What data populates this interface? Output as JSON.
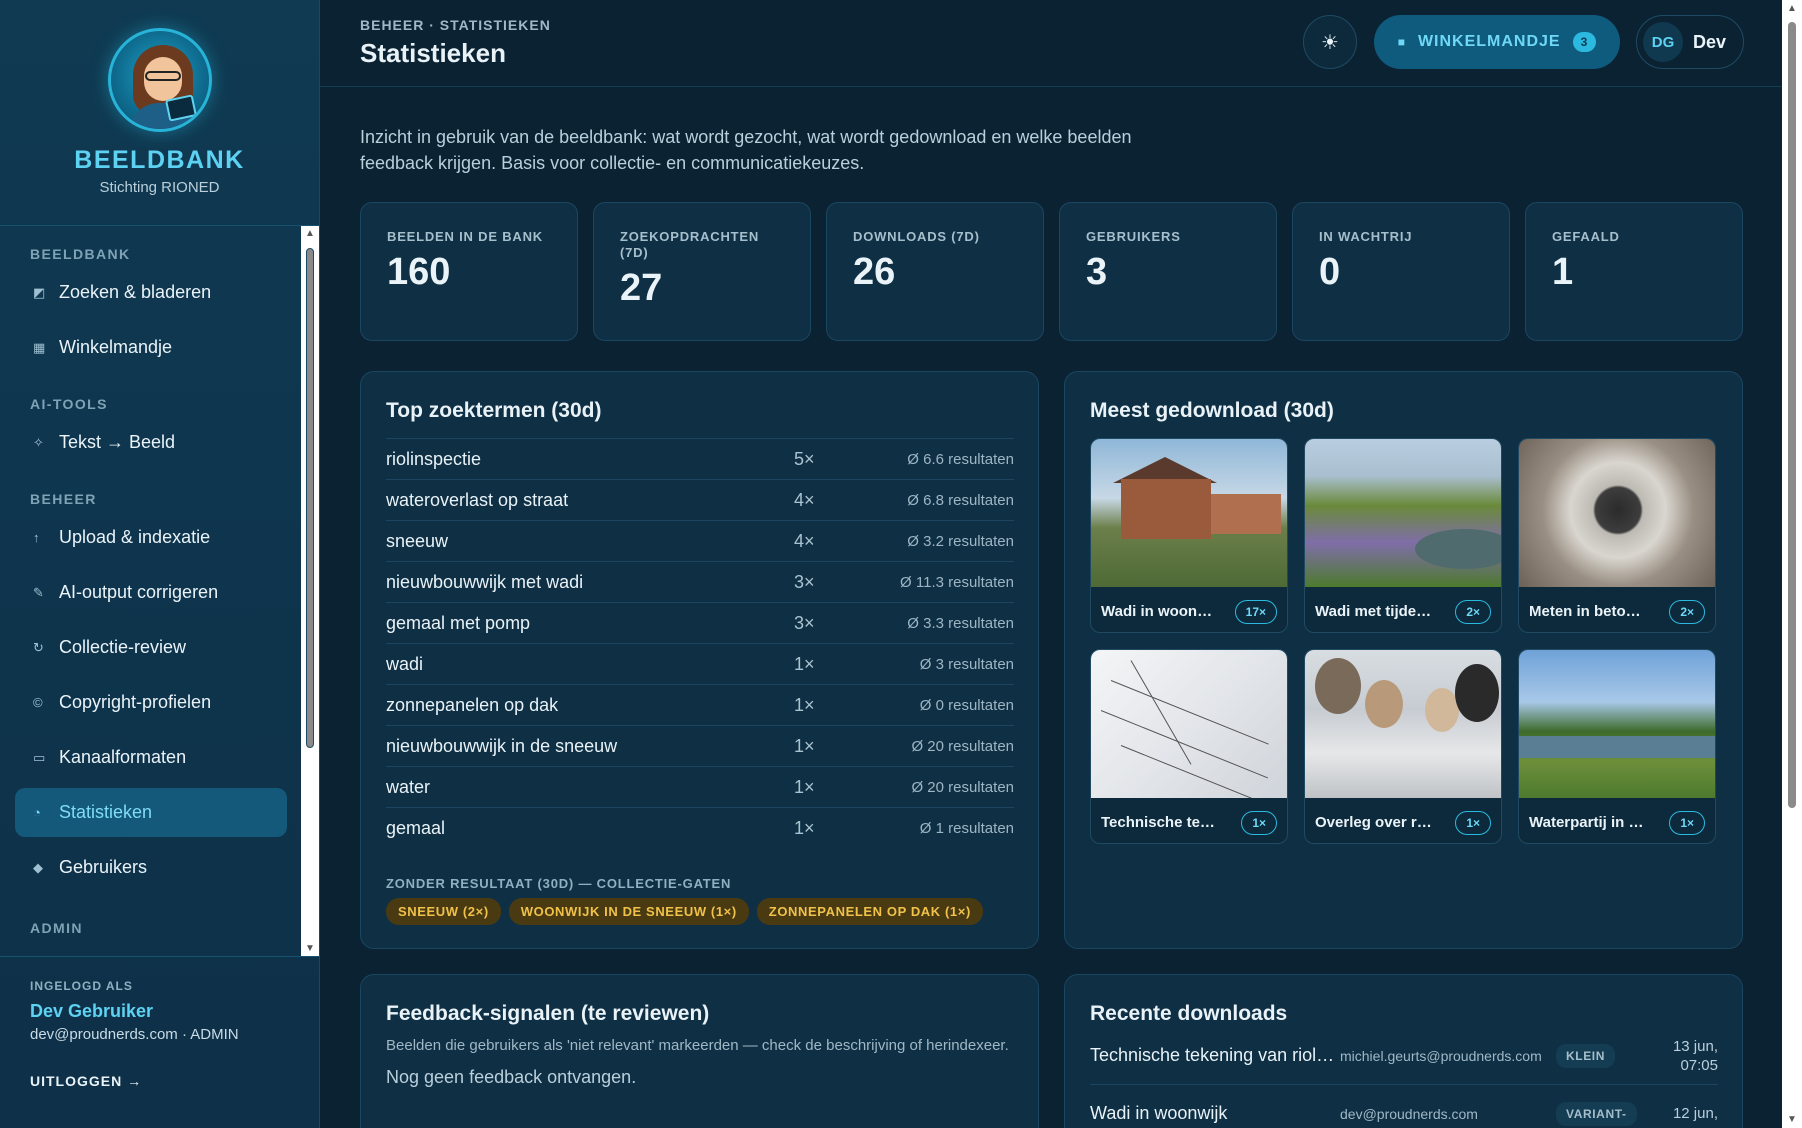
{
  "brand": {
    "title": "BEELDBANK",
    "subtitle": "Stichting RIONED"
  },
  "nav": {
    "sections": [
      {
        "label": "BEELDBANK",
        "items": [
          {
            "label": "Zoeken & bladeren",
            "icon": "image-icon"
          },
          {
            "label": "Winkelmandje",
            "icon": "cart-icon"
          }
        ]
      },
      {
        "label": "AI-TOOLS",
        "items": [
          {
            "label": "Tekst → Beeld",
            "icon": "sparkle-icon"
          }
        ]
      },
      {
        "label": "BEHEER",
        "items": [
          {
            "label": "Upload & indexatie",
            "icon": "upload-icon"
          },
          {
            "label": "AI-output corrigeren",
            "icon": "pencil-icon"
          },
          {
            "label": "Collectie-review",
            "icon": "refresh-icon"
          },
          {
            "label": "Copyright-profielen",
            "icon": "copyright-icon"
          },
          {
            "label": "Kanaalformaten",
            "icon": "frame-icon"
          },
          {
            "label": "Statistieken",
            "icon": "chart-icon",
            "active": true
          },
          {
            "label": "Gebruikers",
            "icon": "users-icon"
          }
        ]
      },
      {
        "label": "ADMIN",
        "items": []
      }
    ]
  },
  "user": {
    "logged_in_label": "INGELOGD ALS",
    "name": "Dev Gebruiker",
    "email_role": "dev@proudnerds.com · ADMIN",
    "logout": "UITLOGGEN →",
    "initials": "DG",
    "short_name": "Dev"
  },
  "header": {
    "breadcrumb": "BEHEER · STATISTIEKEN",
    "title": "Statistieken",
    "theme_icon": "sun-icon",
    "cart_label": "WINKELMANDJE",
    "cart_count": "3"
  },
  "intro": "Inzicht in gebruik van de beeldbank: wat wordt gezocht, wat wordt gedownload en welke beelden feedback krijgen. Basis voor collectie- en communicatiekeuzes.",
  "stats": [
    {
      "label": "BEELDEN IN DE BANK",
      "value": "160"
    },
    {
      "label": "ZOEKOPDRACHTEN (7D)",
      "value": "27"
    },
    {
      "label": "DOWNLOADS (7D)",
      "value": "26"
    },
    {
      "label": "GEBRUIKERS",
      "value": "3"
    },
    {
      "label": "IN WACHTRIJ",
      "value": "0"
    },
    {
      "label": "GEFAALD",
      "value": "1"
    }
  ],
  "top_terms": {
    "title": "Top zoektermen (30d)",
    "rows": [
      {
        "term": "riolinspectie",
        "count": "5×",
        "avg": "Ø 6.6 resultaten"
      },
      {
        "term": "wateroverlast op straat",
        "count": "4×",
        "avg": "Ø 6.8 resultaten"
      },
      {
        "term": "sneeuw",
        "count": "4×",
        "avg": "Ø 3.2 resultaten"
      },
      {
        "term": "nieuwbouwwijk met wadi",
        "count": "3×",
        "avg": "Ø 11.3 resultaten"
      },
      {
        "term": "gemaal met pomp",
        "count": "3×",
        "avg": "Ø 3.3 resultaten"
      },
      {
        "term": "wadi",
        "count": "1×",
        "avg": "Ø 3 resultaten"
      },
      {
        "term": "zonnepanelen op dak",
        "count": "1×",
        "avg": "Ø 0 resultaten"
      },
      {
        "term": "nieuwbouwwijk in de sneeuw",
        "count": "1×",
        "avg": "Ø 20 resultaten"
      },
      {
        "term": "water",
        "count": "1×",
        "avg": "Ø 20 resultaten"
      },
      {
        "term": "gemaal",
        "count": "1×",
        "avg": "Ø 1 resultaten"
      }
    ],
    "gaps_label": "ZONDER RESULTAAT (30D) — COLLECTIE-GATEN",
    "gaps": [
      "SNEEUW (2×)",
      "WOONWIJK IN DE SNEEUW (1×)",
      "ZONNEPANELEN OP DAK (1×)"
    ]
  },
  "most_downloaded": {
    "title": "Meest gedownload (30d)",
    "items": [
      {
        "caption": "Wadi in woonwijk",
        "count": "17×"
      },
      {
        "caption": "Wadi met tijdelijke",
        "count": "2×"
      },
      {
        "caption": "Meten in betonnen",
        "count": "2×"
      },
      {
        "caption": "Technische tekening",
        "count": "1×"
      },
      {
        "caption": "Overleg over riolering",
        "count": "1×"
      },
      {
        "caption": "Waterpartij in stad",
        "count": "1×"
      }
    ]
  },
  "feedback": {
    "title": "Feedback-signalen (te reviewen)",
    "subtitle": "Beelden die gebruikers als 'niet relevant' markeerden — check de beschrijving of herindexeer.",
    "empty": "Nog geen feedback ontvangen."
  },
  "recent_downloads": {
    "title": "Recente downloads",
    "rows": [
      {
        "file": "Technische tekening van riolering",
        "user": "michiel.geurts@proudnerds.com",
        "variant": "KLEIN",
        "date": "13 jun, 07:05"
      },
      {
        "file": "Wadi in woonwijk",
        "user": "dev@proudnerds.com",
        "variant": "VARIANT-",
        "date": "12 jun,"
      }
    ]
  }
}
